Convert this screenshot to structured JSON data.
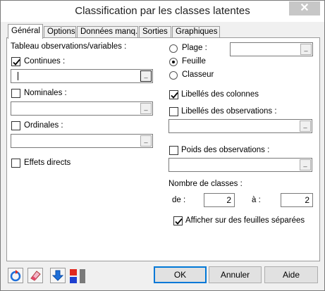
{
  "window": {
    "title": "Classification par les classes latentes",
    "close_glyph": "✕"
  },
  "tabs": [
    {
      "label": "Général",
      "active": true
    },
    {
      "label": "Options",
      "active": false
    },
    {
      "label": "Données manq.",
      "active": false
    },
    {
      "label": "Sorties",
      "active": false
    },
    {
      "label": "Graphiques",
      "active": false
    }
  ],
  "general": {
    "section_label": "Tableau observations/variables :",
    "continues": {
      "label": "Continues :",
      "checked": true,
      "value": ""
    },
    "nominales": {
      "label": "Nominales :",
      "checked": false,
      "value": ""
    },
    "ordinales": {
      "label": "Ordinales :",
      "checked": false,
      "value": ""
    },
    "effets_directs": {
      "label": "Effets directs",
      "checked": false
    },
    "output_target": {
      "options": [
        "Plage :",
        "Feuille",
        "Classeur"
      ],
      "selected": "Feuille",
      "plage_value": ""
    },
    "libelles_colonnes": {
      "label": "Libellés des colonnes",
      "checked": true
    },
    "libelles_observations": {
      "label": "Libellés des observations :",
      "checked": false,
      "value": ""
    },
    "poids_observations": {
      "label": "Poids des observations :",
      "checked": false,
      "value": ""
    },
    "nombre_classes": {
      "label": "Nombre de classes :",
      "from_label": "de :",
      "from_value": "2",
      "to_label": "à :",
      "to_value": "2"
    },
    "feuilles_separees": {
      "label": "Afficher sur des feuilles séparées",
      "checked": true
    }
  },
  "browse_glyph": "_",
  "footer": {
    "ok_label": "OK",
    "cancel_label": "Annuler",
    "help_label": "Aide"
  },
  "toolbar_icons": [
    "reset-icon",
    "eraser-icon",
    "download-arrow-icon",
    "color-blocks-icon"
  ],
  "colors": {
    "accent_blue": "#0078d7",
    "arrow_blue": "#1e6fd9",
    "red": "#e0281e"
  }
}
